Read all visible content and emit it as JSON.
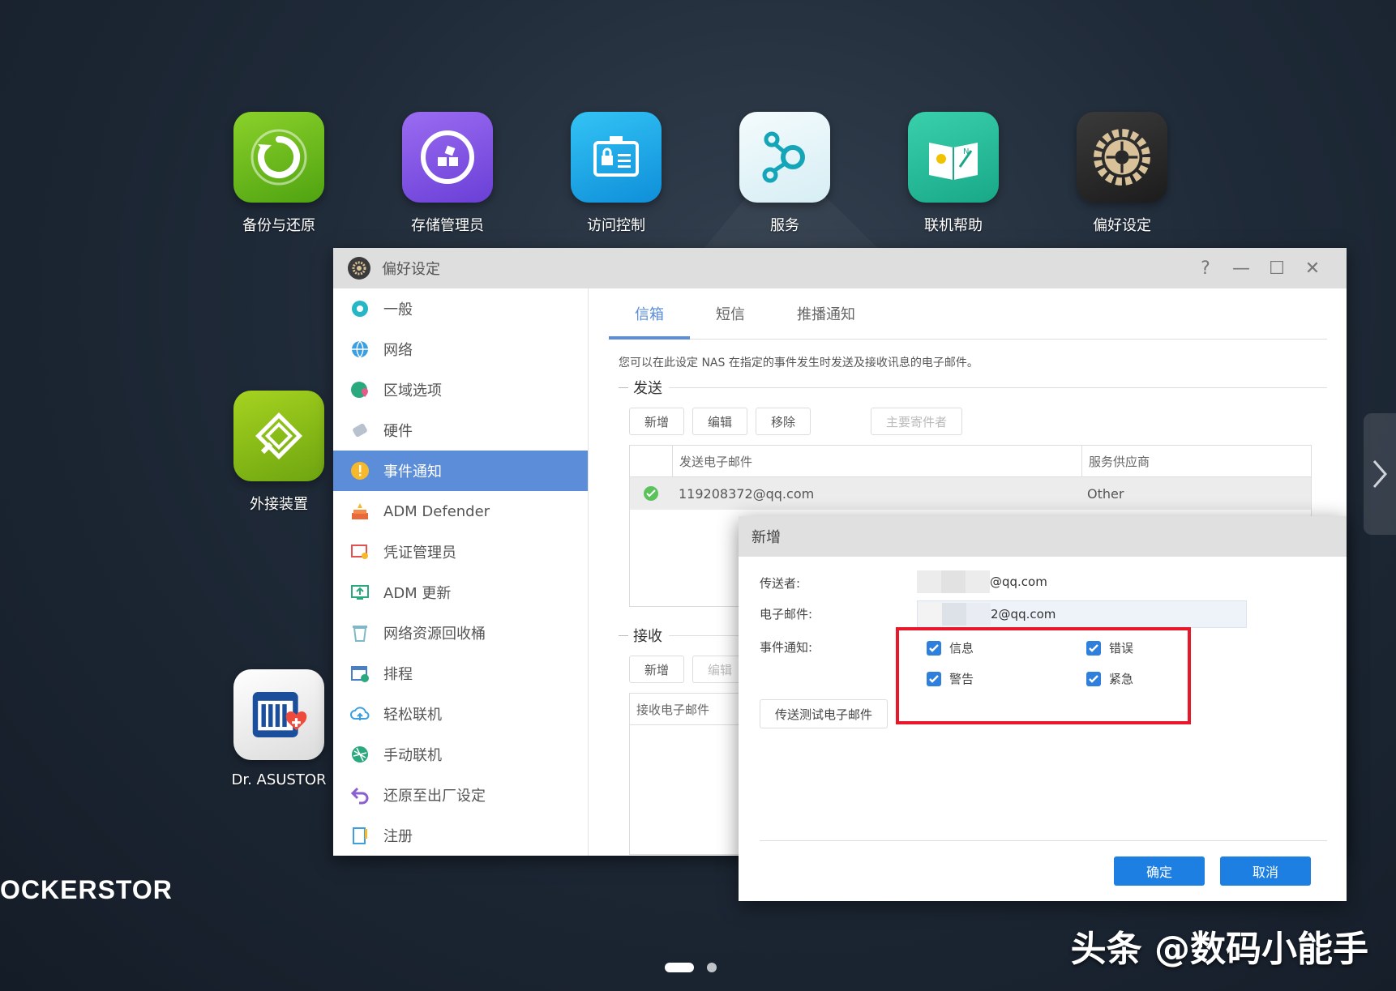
{
  "desktop": {
    "apps": [
      {
        "label": "备份与还原",
        "icon": "backup-restore-icon"
      },
      {
        "label": "存储管理员",
        "icon": "storage-manager-icon"
      },
      {
        "label": "访问控制",
        "icon": "access-control-icon"
      },
      {
        "label": "服务",
        "icon": "services-icon"
      },
      {
        "label": "联机帮助",
        "icon": "online-help-icon"
      },
      {
        "label": "偏好设定",
        "icon": "preferences-gear-icon"
      },
      {
        "label": "外接装置",
        "icon": "external-devices-icon"
      },
      {
        "label": "Dr. ASUSTOR",
        "icon": "dr-asustor-icon"
      }
    ],
    "brand": "OCKERSTOR",
    "watermark": "头条 @数码小能手"
  },
  "window": {
    "title": "偏好设定",
    "controls": {
      "help": "?",
      "minimize": "—",
      "maximize": "☐",
      "close": "✕"
    }
  },
  "sidebar": {
    "items": [
      {
        "label": "一般"
      },
      {
        "label": "网络"
      },
      {
        "label": "区域选项"
      },
      {
        "label": "硬件"
      },
      {
        "label": "事件通知"
      },
      {
        "label": "ADM Defender"
      },
      {
        "label": "凭证管理员"
      },
      {
        "label": "ADM 更新"
      },
      {
        "label": "网络资源回收桶"
      },
      {
        "label": "排程"
      },
      {
        "label": "轻松联机"
      },
      {
        "label": "手动联机"
      },
      {
        "label": "还原至出厂设定"
      },
      {
        "label": "注册"
      }
    ],
    "active_index": 4
  },
  "tabs": [
    {
      "label": "信箱"
    },
    {
      "label": "短信"
    },
    {
      "label": "推播通知"
    }
  ],
  "content": {
    "description": "您可以在此设定 NAS 在指定的事件发生时发送及接收讯息的电子邮件。",
    "send": {
      "section": "发送",
      "buttons": {
        "add": "新增",
        "edit": "编辑",
        "remove": "移除",
        "primary": "主要寄件者"
      },
      "columns": [
        "发送电子邮件",
        "服务供应商"
      ],
      "rows": [
        {
          "email": "119208372@qq.com",
          "provider": "Other"
        }
      ]
    },
    "receive": {
      "section": "接收",
      "buttons": {
        "add": "新增",
        "edit": "编辑"
      },
      "columns": [
        "接收电子邮件"
      ]
    }
  },
  "dialog": {
    "title": "新增",
    "sender_label": "传送者:",
    "sender_value": "@qq.com",
    "email_label": "电子邮件:",
    "email_value": "2@qq.com",
    "event_label": "事件通知:",
    "checks": {
      "info": "信息",
      "error": "错误",
      "warning": "警告",
      "critical": "紧急"
    },
    "test_button": "传送测试电子邮件",
    "ok": "确定",
    "cancel": "取消"
  },
  "colors": {
    "accent": "#5b8dd9",
    "primary_button": "#1d7fe1",
    "highlight": "#e8182a"
  }
}
